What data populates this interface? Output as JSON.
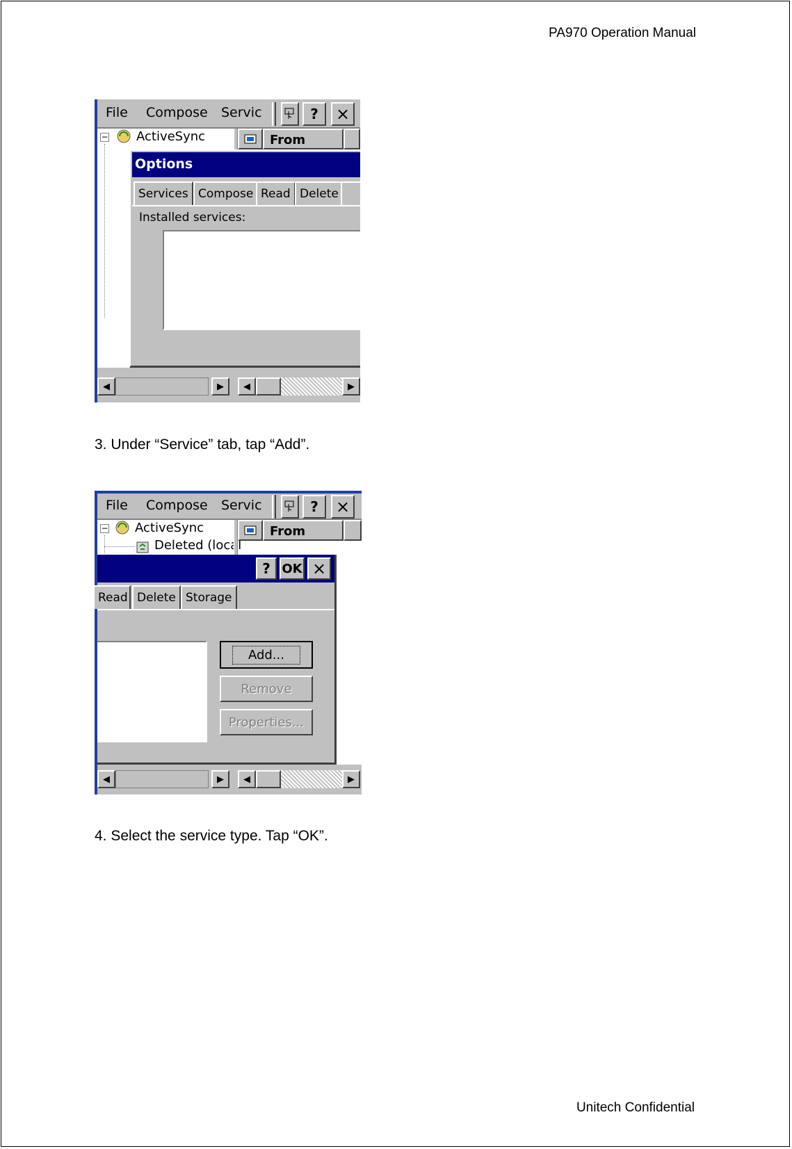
{
  "header": {
    "title": "PA970 Operation Manual"
  },
  "footer": {
    "text": "Unitech Confidential"
  },
  "steps": [
    {
      "text": "3. Under “Service” tab, tap “Add”."
    },
    {
      "text": "4. Select the service type. Tap “OK”."
    }
  ],
  "screenshot1": {
    "menu": {
      "file": "File",
      "compose": "Compose",
      "services": "Servic"
    },
    "toolbar": {
      "help": "?",
      "close": "×"
    },
    "tree": {
      "root": "ActiveSync"
    },
    "list_header": {
      "from": "From"
    },
    "dialog": {
      "title": "Options",
      "tabs": [
        "Services",
        "Compose",
        "Read",
        "Delete"
      ],
      "installed_label": "Installed services:"
    }
  },
  "screenshot2": {
    "menu": {
      "file": "File",
      "compose": "Compose",
      "services": "Servic"
    },
    "toolbar": {
      "help": "?",
      "close": "×"
    },
    "tree": {
      "root": "ActiveSync",
      "child": "Deleted (local"
    },
    "list_header": {
      "from": "From"
    },
    "dialog": {
      "title_buttons": {
        "help": "?",
        "ok": "OK",
        "close": "×"
      },
      "tabs": [
        "Read",
        "Delete",
        "Storage"
      ],
      "buttons": {
        "add": "Add...",
        "remove": "Remove",
        "properties": "Properties..."
      }
    }
  },
  "colors": {
    "titlebar": "#000080",
    "chrome": "#c0c0c0"
  },
  "icons": [
    "collapse-tree-icon",
    "activesync-icon",
    "recycle-folder-icon",
    "message-icon",
    "tap-and-hold-icon",
    "scroll-left-icon",
    "scroll-right-icon"
  ]
}
